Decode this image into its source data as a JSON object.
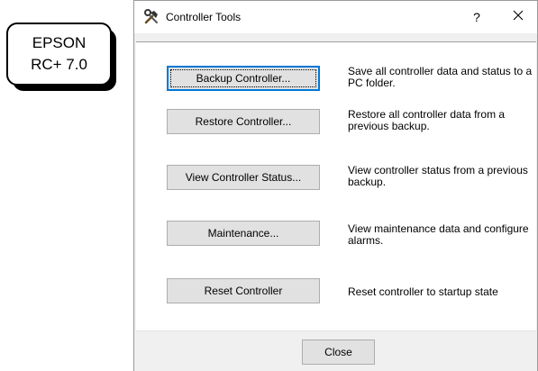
{
  "badge": {
    "line1": "EPSON",
    "line2": "RC+ 7.0"
  },
  "window": {
    "title": "Controller Tools",
    "help_label": "?",
    "app_icon": "tools-icon",
    "close_icon": "close-icon"
  },
  "actions": [
    {
      "label": "Backup Controller...",
      "description": "Save all controller data and status to a PC folder."
    },
    {
      "label": "Restore Controller...",
      "description": "Restore all controller data from a previous backup."
    },
    {
      "label": "View Controller Status...",
      "description": "View controller status from a previous backup."
    },
    {
      "label": "Maintenance...",
      "description": "View maintenance data and configure alarms."
    },
    {
      "label": "Reset Controller",
      "description": "Reset controller to startup state"
    }
  ],
  "footer": {
    "close_label": "Close"
  },
  "colors": {
    "focus_border": "#0078d7",
    "button_face": "#e1e1e1",
    "dialog_bg": "#f0f0f0"
  }
}
